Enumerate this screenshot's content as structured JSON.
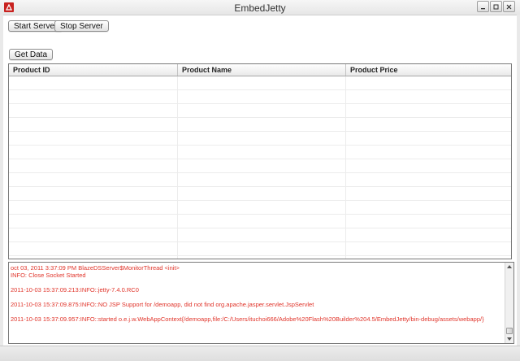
{
  "window": {
    "title": "EmbedJetty"
  },
  "toolbar": {
    "start_label": "Start Server",
    "stop_label": "Stop Server",
    "get_data_label": "Get Data"
  },
  "grid": {
    "columns": [
      "Product ID",
      "Product Name",
      "Product Price"
    ],
    "rows": []
  },
  "log": {
    "lines": [
      "oct 03, 2011 3:37:09 PM BlazeDSServer$MonitorThread <init>",
      "INFO: Close Socket Started",
      "",
      "2011-10-03 15:37:09.213:INFO::jetty-7.4.0.RC0",
      "",
      "2011-10-03 15:37:09.875:INFO::NO JSP Support for /demoapp, did not find org.apache.jasper.servlet.JspServlet",
      "",
      "2011-10-03 15:37:09.957:INFO::started o.e.j.w.WebAppContext{/demoapp,file:/C:/Users/ituchoi666/Adobe%20Flash%20Builder%204.5/EmbedJetty/bin-debug/assets/webapp/}"
    ]
  },
  "colors": {
    "log_text": "#e0342a",
    "app_icon": "#c8221f"
  }
}
